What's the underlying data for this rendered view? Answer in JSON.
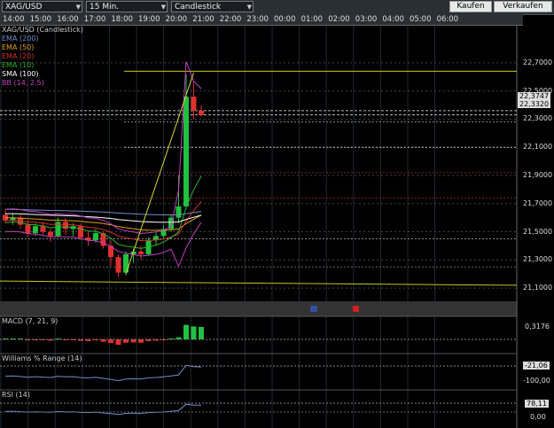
{
  "toolbar": {
    "symbol": "XAG/USD",
    "interval": "15 Min.",
    "chart_type": "Candlestick",
    "buy_label": "Kaufen",
    "sell_label": "Verkaufen"
  },
  "time_labels": [
    "14:00",
    "15:00",
    "16:00",
    "17:00",
    "18:00",
    "19:00",
    "20:00",
    "21:00",
    "22:00",
    "23:00",
    "00:00",
    "01:00",
    "02:00",
    "03:00",
    "04:00",
    "05:00",
    "06:00"
  ],
  "legend": [
    {
      "text": "XAG/USD (Candlestick)",
      "color": "#cccccc"
    },
    {
      "text": "EMA (200)",
      "color": "#6f8fc9"
    },
    {
      "text": "EMA (50)",
      "color": "#e0a020"
    },
    {
      "text": "EMA (20)",
      "color": "#d03030"
    },
    {
      "text": "EMA (10)",
      "color": "#30b030"
    },
    {
      "text": "SMA (100)",
      "color": "#ffffff"
    },
    {
      "text": "BB (14, 2.5)",
      "color": "#c040c0"
    }
  ],
  "price_labels": [
    "22,7000",
    "22,5000",
    "22,3000",
    "22,1000",
    "21,9000",
    "21,7000",
    "21,5000",
    "21,3000",
    "21,1000"
  ],
  "price_tags": [
    "22,3747",
    "22,3320"
  ],
  "panels": {
    "macd": {
      "title": "MACD (7, 21, 9)",
      "value": "0,3176"
    },
    "williams": {
      "title": "Williams % Range (14)",
      "value": "-21,06",
      "axis": "-100,00"
    },
    "rsi": {
      "title": "RSI (14)",
      "value": "78,11",
      "axis": "0,00"
    }
  },
  "chart_data": {
    "type": "candlestick",
    "title": "XAG/USD (Candlestick)",
    "interval": "15 Min.",
    "ylim": [
      21.0,
      22.8
    ],
    "candles": [
      {
        "time": "14:00",
        "o": 21.62,
        "h": 21.66,
        "l": 21.56,
        "c": 21.58
      },
      {
        "time": "14:15",
        "o": 21.58,
        "h": 21.63,
        "l": 21.55,
        "c": 21.6
      },
      {
        "time": "14:30",
        "o": 21.6,
        "h": 21.62,
        "l": 21.52,
        "c": 21.55
      },
      {
        "time": "14:45",
        "o": 21.55,
        "h": 21.58,
        "l": 21.46,
        "c": 21.49
      },
      {
        "time": "15:00",
        "o": 21.49,
        "h": 21.56,
        "l": 21.47,
        "c": 21.54
      },
      {
        "time": "15:15",
        "o": 21.54,
        "h": 21.57,
        "l": 21.48,
        "c": 21.5
      },
      {
        "time": "15:30",
        "o": 21.5,
        "h": 21.52,
        "l": 21.43,
        "c": 21.47
      },
      {
        "time": "15:45",
        "o": 21.47,
        "h": 21.6,
        "l": 21.46,
        "c": 21.57
      },
      {
        "time": "16:00",
        "o": 21.57,
        "h": 21.6,
        "l": 21.48,
        "c": 21.52
      },
      {
        "time": "16:15",
        "o": 21.52,
        "h": 21.56,
        "l": 21.47,
        "c": 21.54
      },
      {
        "time": "16:30",
        "o": 21.54,
        "h": 21.56,
        "l": 21.44,
        "c": 21.46
      },
      {
        "time": "16:45",
        "o": 21.46,
        "h": 21.5,
        "l": 21.4,
        "c": 21.44
      },
      {
        "time": "17:00",
        "o": 21.44,
        "h": 21.52,
        "l": 21.42,
        "c": 21.49
      },
      {
        "time": "17:15",
        "o": 21.49,
        "h": 21.5,
        "l": 21.38,
        "c": 21.4
      },
      {
        "time": "17:30",
        "o": 21.4,
        "h": 21.44,
        "l": 21.26,
        "c": 21.32
      },
      {
        "time": "17:45",
        "o": 21.32,
        "h": 21.34,
        "l": 21.18,
        "c": 21.21
      },
      {
        "time": "18:00",
        "o": 21.21,
        "h": 21.36,
        "l": 21.19,
        "c": 21.34
      },
      {
        "time": "18:15",
        "o": 21.34,
        "h": 21.38,
        "l": 21.28,
        "c": 21.36
      },
      {
        "time": "18:30",
        "o": 21.36,
        "h": 21.4,
        "l": 21.3,
        "c": 21.34
      },
      {
        "time": "18:45",
        "o": 21.34,
        "h": 21.46,
        "l": 21.33,
        "c": 21.44
      },
      {
        "time": "19:00",
        "o": 21.44,
        "h": 21.5,
        "l": 21.4,
        "c": 21.47
      },
      {
        "time": "19:15",
        "o": 21.47,
        "h": 21.55,
        "l": 21.45,
        "c": 21.52
      },
      {
        "time": "19:30",
        "o": 21.52,
        "h": 21.62,
        "l": 21.5,
        "c": 21.6
      },
      {
        "time": "19:45",
        "o": 21.6,
        "h": 21.9,
        "l": 21.56,
        "c": 21.68
      },
      {
        "time": "20:00",
        "o": 21.68,
        "h": 22.62,
        "l": 21.66,
        "c": 22.46
      },
      {
        "time": "20:15",
        "o": 22.46,
        "h": 22.56,
        "l": 22.3,
        "c": 22.36
      },
      {
        "time": "20:30",
        "o": 22.36,
        "h": 22.4,
        "l": 22.32,
        "c": 22.33
      }
    ]
  }
}
